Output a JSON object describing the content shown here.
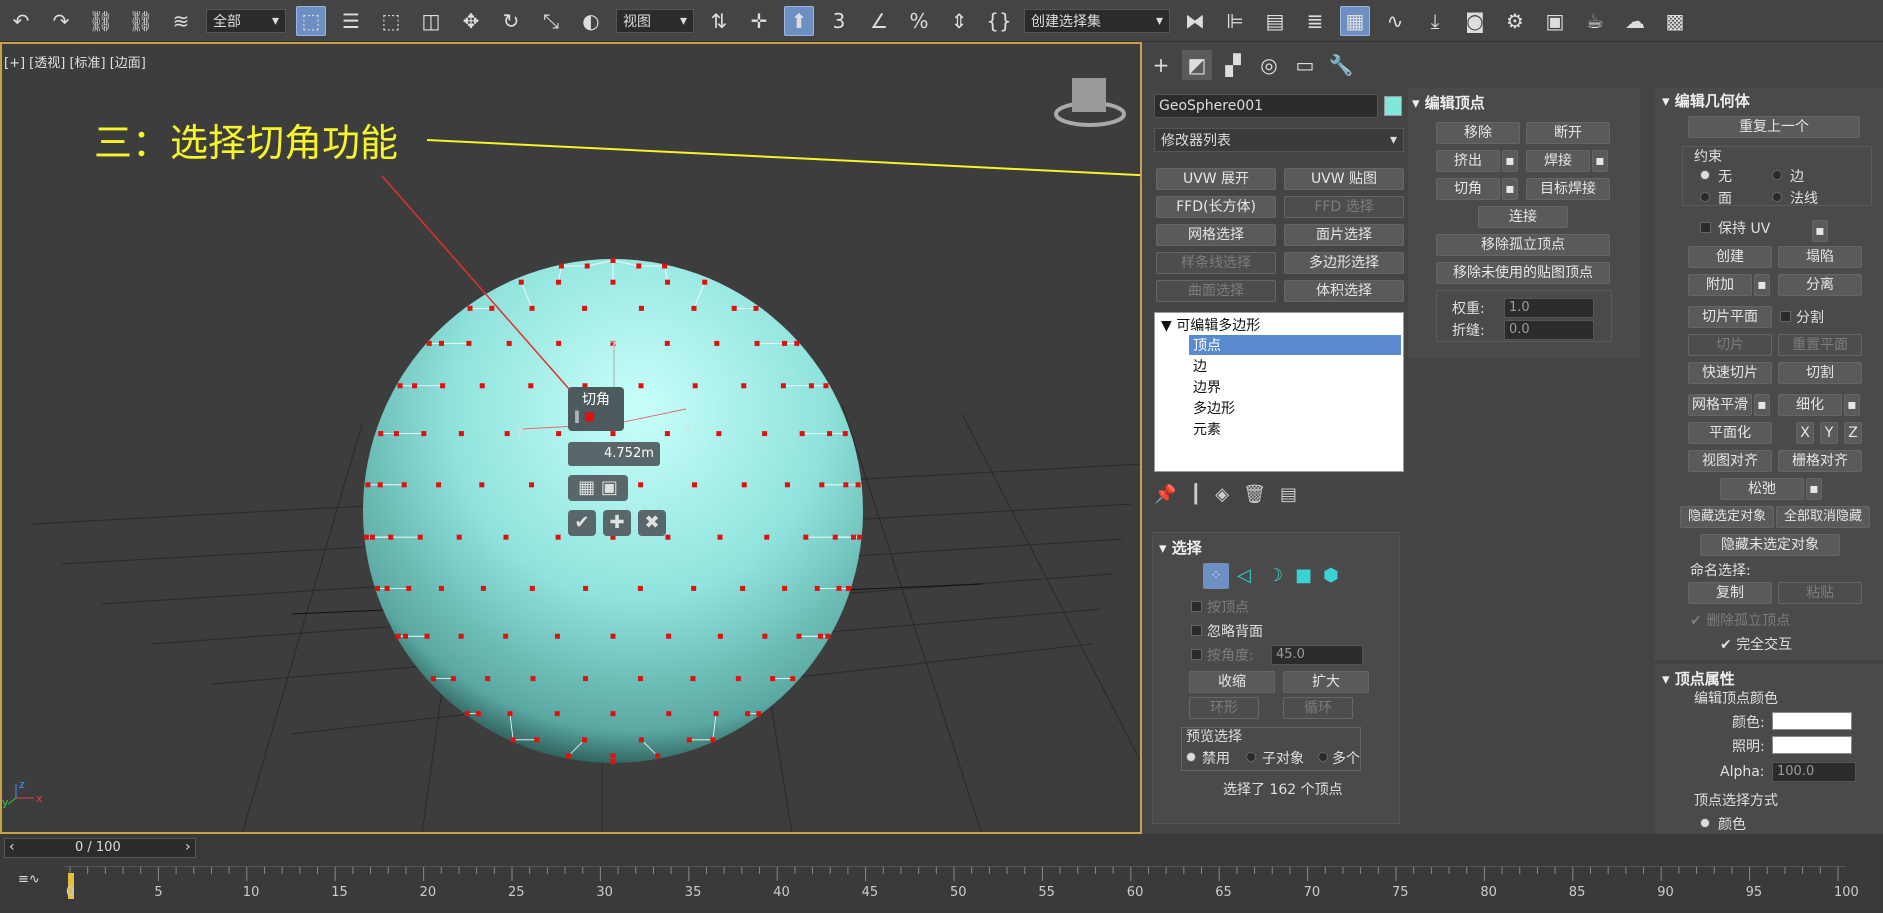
{
  "toolbar": {
    "filter_dropdown": "全部",
    "refcoord_dropdown": "视图",
    "named_selection_dropdown": "创建选择集",
    "icons": [
      "undo-icon",
      "redo-icon",
      "link-icon",
      "unlink-icon",
      "bind-space-warp-icon",
      "select-object-icon",
      "select-by-name-icon",
      "rect-region-icon",
      "window-crossing-icon",
      "move-icon",
      "rotate-icon",
      "scale-icon",
      "place-icon",
      "pivot-icon",
      "manipulate-icon",
      "keyboard-shortcut-icon",
      "snap-3d-icon",
      "angle-snap-icon",
      "percent-snap-icon",
      "spinner-snap-icon",
      "edit-named-selection-icon",
      "mirror-icon",
      "align-icon",
      "toggle-scene-explorer-icon",
      "layer-explorer-icon",
      "ribbon-icon",
      "curve-editor-icon",
      "schematic-view-icon",
      "material-editor-icon",
      "render-setup-icon",
      "render-frame-icon",
      "render-icon",
      "render-online-icon",
      "render-production-icon"
    ]
  },
  "viewport": {
    "label": "[+] [透视] [标准] [边面]",
    "annotation": "三：选择切角功能",
    "caddy_title": "切角",
    "caddy_value": "4.752m",
    "axis_x": "x",
    "axis_y": "y",
    "axis_z": "z",
    "corner_axis_x": "x",
    "corner_axis_y": "y",
    "corner_axis_z": "z"
  },
  "command_panel": {
    "tabs": [
      "create-tab",
      "modify-tab",
      "hierarchy-tab",
      "motion-tab",
      "display-tab",
      "utilities-tab"
    ],
    "object_name": "GeoSphere001",
    "object_color": "#7fe8d8",
    "modifier_list": "修改器列表",
    "modifier_buttons": [
      {
        "label": "UVW 展开",
        "disabled": false
      },
      {
        "label": "UVW 贴图",
        "disabled": false
      },
      {
        "label": "FFD(长方体)",
        "disabled": false
      },
      {
        "label": "FFD 选择",
        "disabled": true
      },
      {
        "label": "网格选择",
        "disabled": false
      },
      {
        "label": "面片选择",
        "disabled": false
      },
      {
        "label": "样条线选择",
        "disabled": true
      },
      {
        "label": "多边形选择",
        "disabled": false
      },
      {
        "label": "曲面选择",
        "disabled": true
      },
      {
        "label": "体积选择",
        "disabled": false
      }
    ],
    "stack": {
      "root": "可编辑多边形",
      "items": [
        "顶点",
        "边",
        "边界",
        "多边形",
        "元素"
      ],
      "selected": "顶点"
    },
    "selection": {
      "header": "选择",
      "by_vertex": "按顶点",
      "ignore_backfacing": "忽略背面",
      "by_angle": "按角度:",
      "angle_value": "45.0",
      "shrink": "收缩",
      "grow": "扩大",
      "ring": "环形",
      "loop": "循环",
      "preview_title": "预览选择",
      "preview_options": [
        "禁用",
        "子对象",
        "多个"
      ],
      "status": "选择了 162 个顶点"
    }
  },
  "edit_vertices": {
    "header": "编辑顶点",
    "remove": "移除",
    "break": "断开",
    "extrude": "挤出",
    "weld": "焊接",
    "chamfer": "切角",
    "target_weld": "目标焊接",
    "connect": "连接",
    "remove_isolated": "移除孤立顶点",
    "remove_unused_map": "移除未使用的贴图顶点",
    "weight_label": "权重:",
    "weight_value": "1.0",
    "crease_label": "折缝:",
    "crease_value": "0.0"
  },
  "edit_geometry": {
    "header": "编辑几何体",
    "repeat_last": "重复上一个",
    "constraints": "约束",
    "c_none": "无",
    "c_edge": "边",
    "c_face": "面",
    "c_normal": "法线",
    "preserve_uv": "保持 UV",
    "create": "创建",
    "collapse": "塌陷",
    "attach": "附加",
    "detach": "分离",
    "slice_plane": "切片平面",
    "split": "分割",
    "slice": "切片",
    "reset_plane": "重置平面",
    "quickslice": "快速切片",
    "cut": "切割",
    "meshsmooth": "网格平滑",
    "tessellate": "细化",
    "make_planar": "平面化",
    "x": "X",
    "y": "Y",
    "z": "Z",
    "view_align": "视图对齐",
    "grid_align": "栅格对齐",
    "relax": "松弛",
    "hide_selected": "隐藏选定对象",
    "unhide_all": "全部取消隐藏",
    "hide_unselected": "隐藏未选定对象",
    "named_selections": "命名选择:",
    "copy": "复制",
    "paste": "粘贴",
    "delete_isolated": "删除孤立顶点",
    "full_interactivity": "完全交互"
  },
  "vertex_properties": {
    "header": "顶点属性",
    "edit_color": "编辑顶点颜色",
    "color_label": "颜色:",
    "illum_label": "照明:",
    "alpha_label": "Alpha:",
    "alpha_value": "100.0",
    "select_by": "顶点选择方式",
    "color_option": "颜色"
  },
  "timeline": {
    "frame_counter": "0 / 100",
    "ticks": [
      "0",
      "5",
      "10",
      "15",
      "20",
      "25",
      "30",
      "35",
      "40",
      "45",
      "50",
      "55",
      "60",
      "65",
      "70",
      "75",
      "80",
      "85",
      "90",
      "95",
      "100"
    ]
  },
  "colors": {
    "accent": "#f5f52a",
    "selection_blue": "#6d8fc2",
    "sphere": "#8fe3dc",
    "vertex_red": "#e01010"
  }
}
